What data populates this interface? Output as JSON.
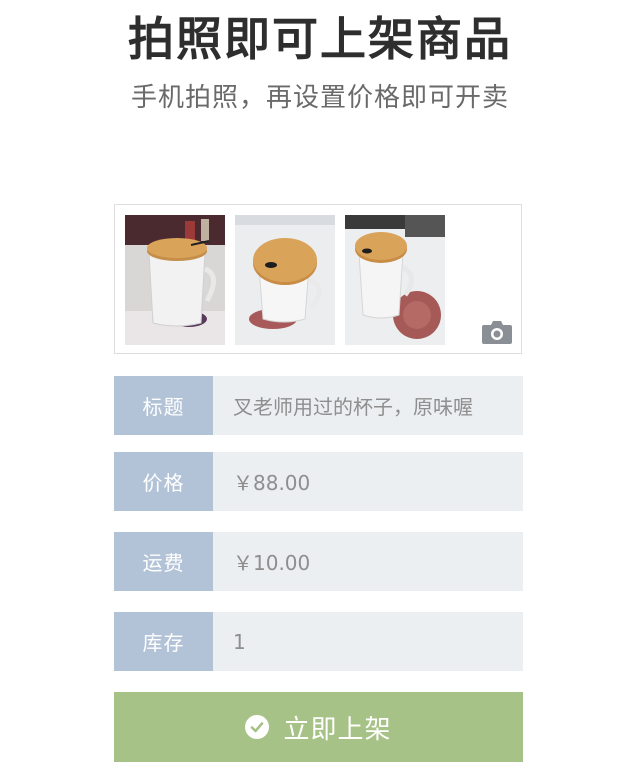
{
  "header": {
    "title": "拍照即可上架商品",
    "subtitle": "手机拍照，再设置价格即可开卖"
  },
  "photos": {
    "count": 3,
    "add_icon": "camera-icon"
  },
  "form": {
    "title": {
      "label": "标题",
      "value": "叉老师用过的杯子，原味喔"
    },
    "price": {
      "label": "价格",
      "value": "￥88.00"
    },
    "shipping": {
      "label": "运费",
      "value": "￥10.00"
    },
    "stock": {
      "label": "库存",
      "value": "1"
    }
  },
  "submit": {
    "label": "立即上架",
    "icon": "check-circle-icon"
  },
  "colors": {
    "label_bg": "#b3c3d7",
    "input_bg": "#eceff2",
    "submit_bg": "#a7c286"
  }
}
